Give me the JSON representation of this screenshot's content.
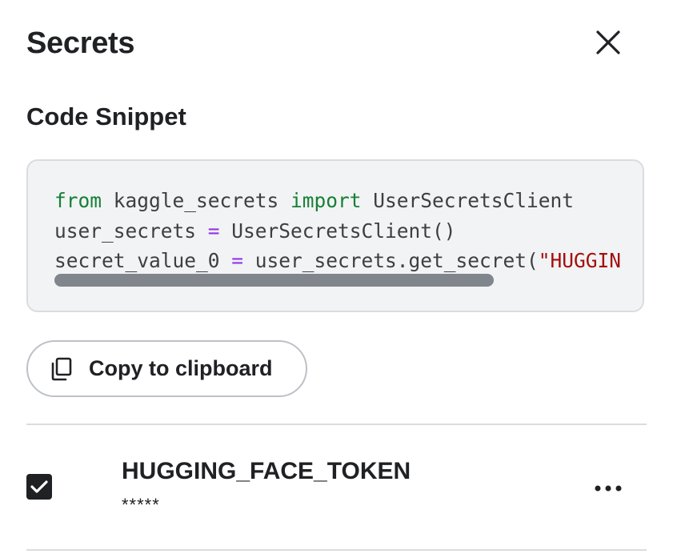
{
  "panel": {
    "title": "Secrets",
    "close_icon": "close-icon"
  },
  "snippet": {
    "title": "Code Snippet",
    "lines": [
      [
        {
          "t": "from",
          "c": "kw"
        },
        {
          "t": " kaggle_secrets ",
          "c": ""
        },
        {
          "t": "import",
          "c": "kw"
        },
        {
          "t": " UserSecretsClient",
          "c": ""
        }
      ],
      [
        {
          "t": "user_secrets ",
          "c": ""
        },
        {
          "t": "=",
          "c": "op"
        },
        {
          "t": " UserSecretsClient()",
          "c": ""
        }
      ],
      [
        {
          "t": "secret_value_0 ",
          "c": ""
        },
        {
          "t": "=",
          "c": "op"
        },
        {
          "t": " user_secrets.get_secret(",
          "c": ""
        },
        {
          "t": "\"HUGGING_FACE_TOKEN\"",
          "c": "str"
        },
        {
          "t": ")",
          "c": ""
        }
      ]
    ],
    "colors": {
      "keyword": "#188038",
      "operator": "#9334e6",
      "string": "#a50e0e",
      "background": "#f1f3f4"
    }
  },
  "copy_button": {
    "label": "Copy to clipboard",
    "icon": "copy-icon"
  },
  "secrets": [
    {
      "name": "HUGGING_FACE_TOKEN",
      "value_masked": "*****",
      "attached": true,
      "menu_icon": "more-horizontal-icon"
    }
  ]
}
